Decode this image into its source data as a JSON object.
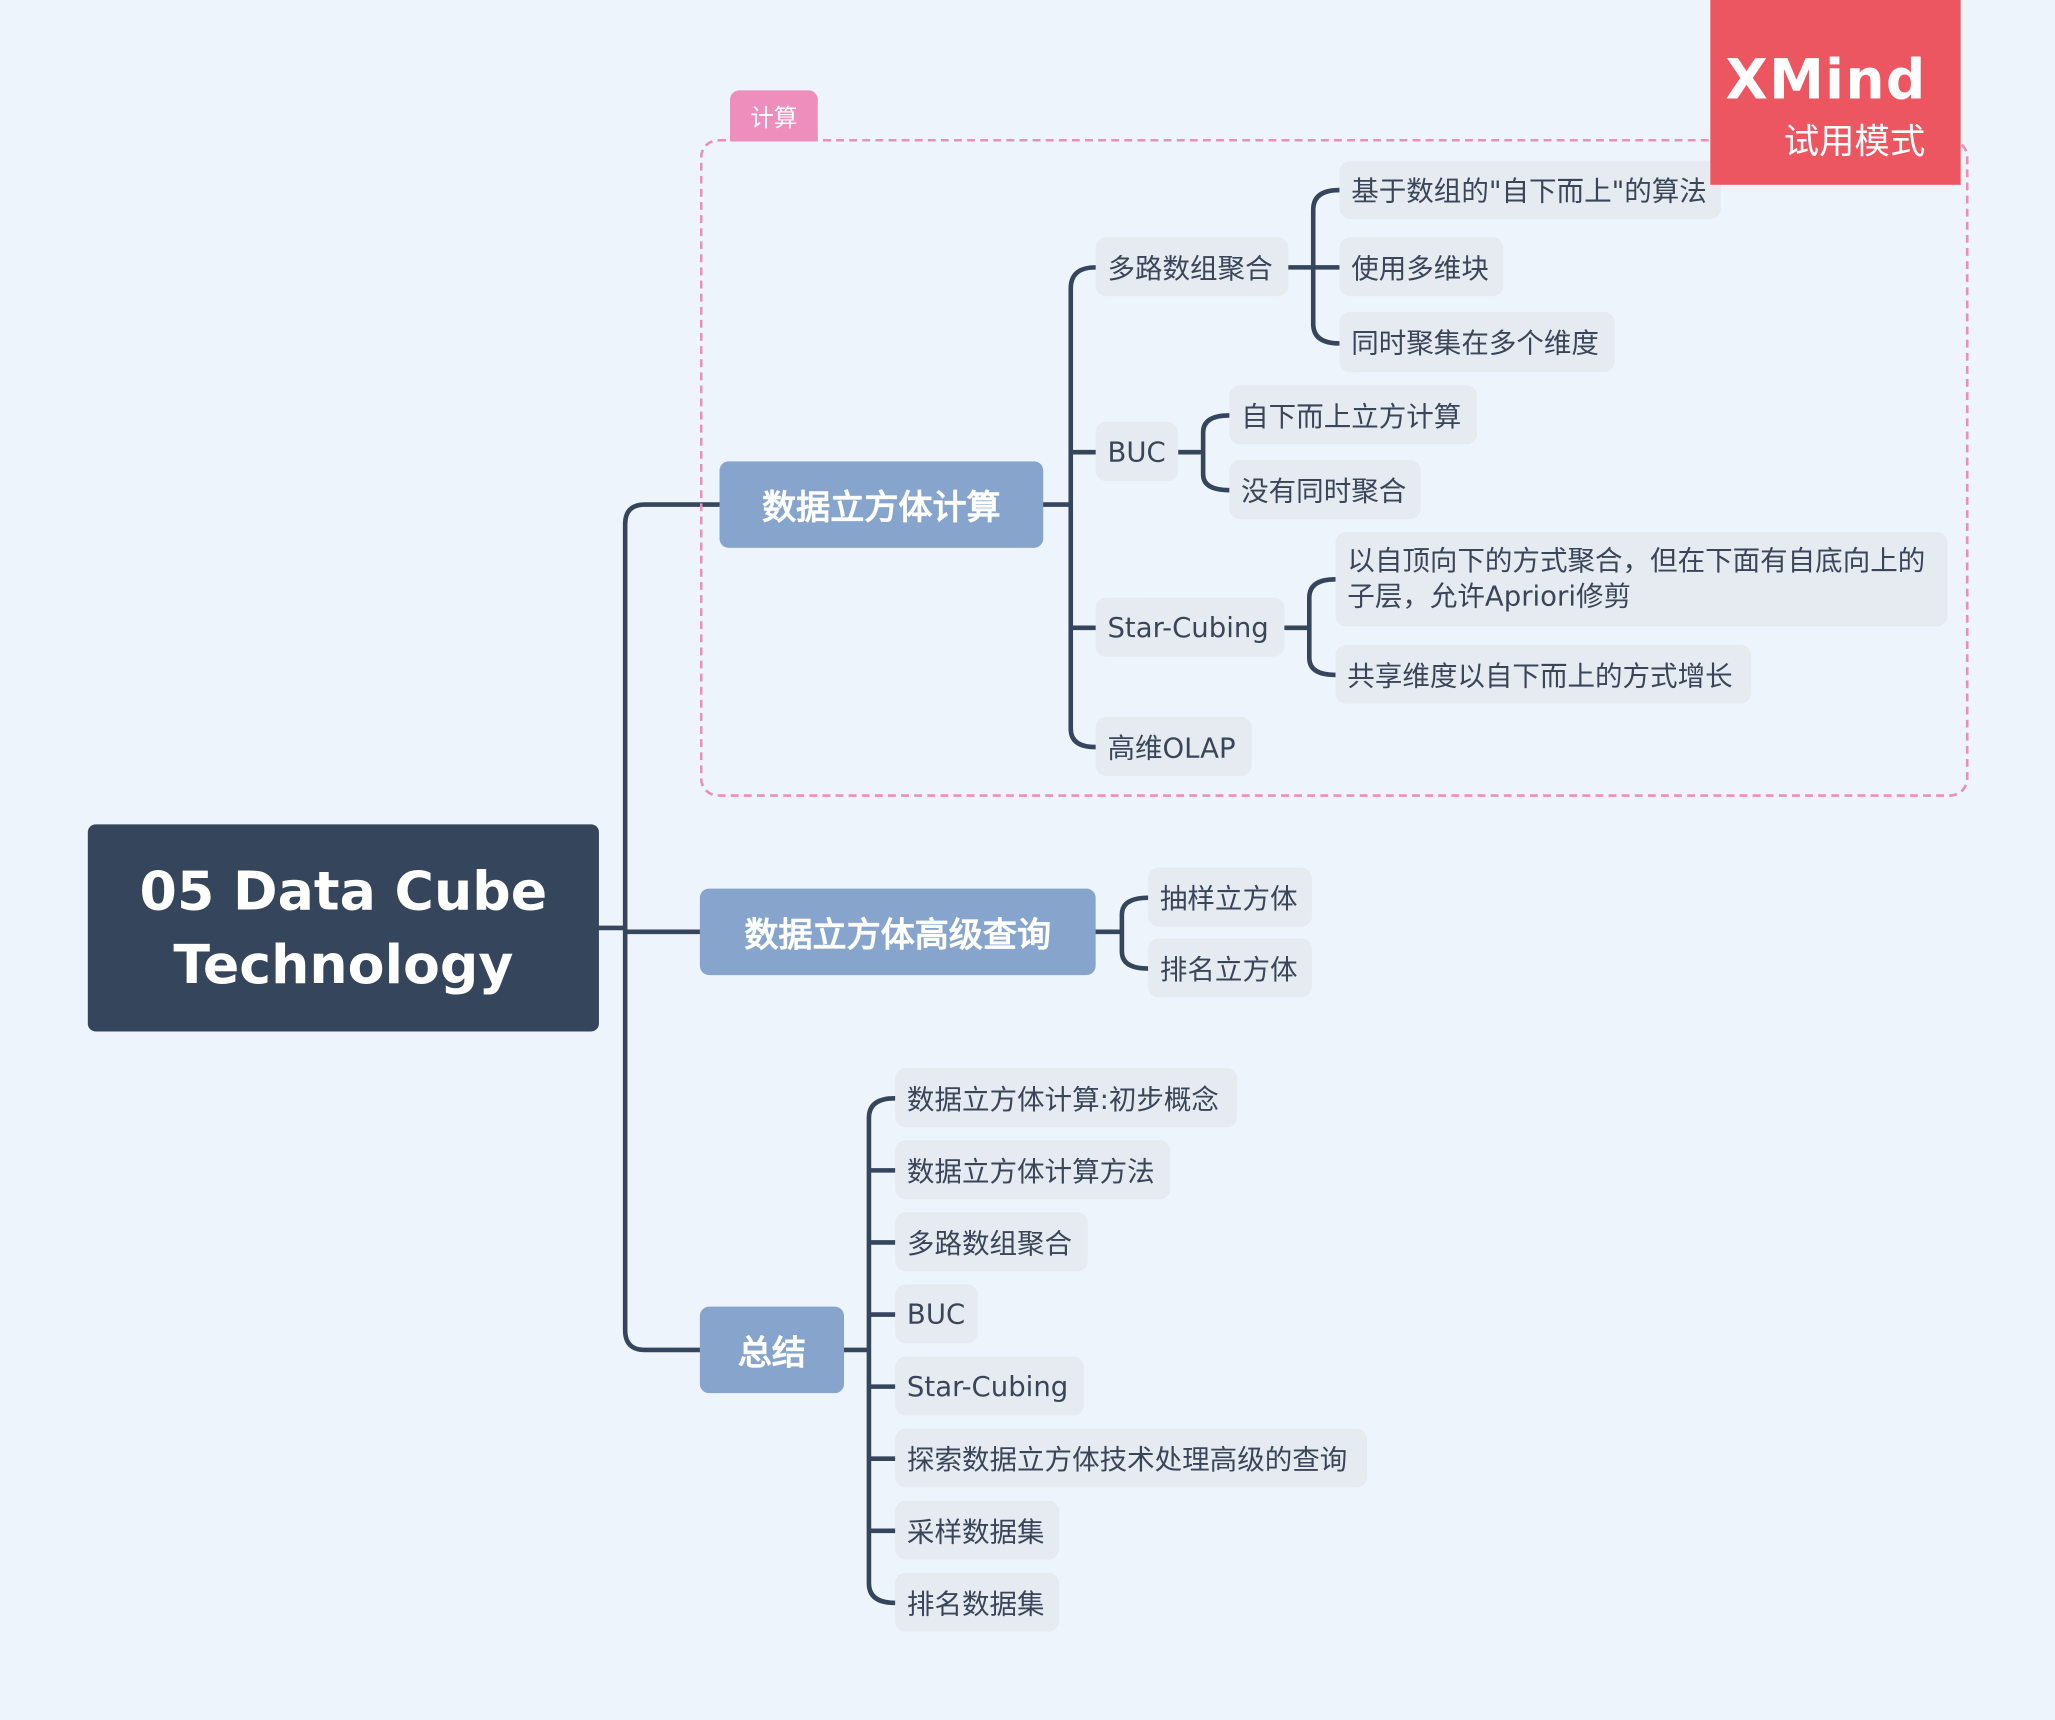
{
  "root": {
    "title": "05 Data Cube Technology"
  },
  "boundary": {
    "label": "计算"
  },
  "watermark": {
    "brand": "XMind",
    "mode": "试用模式"
  },
  "branches": [
    {
      "label": "数据立方体计算",
      "children": [
        {
          "label": "多路数组聚合",
          "children": [
            {
              "label": "基于数组的\"自下而上\"的算法"
            },
            {
              "label": "使用多维块"
            },
            {
              "label": "同时聚集在多个维度"
            }
          ]
        },
        {
          "label": "BUC",
          "children": [
            {
              "label": "自下而上立方计算"
            },
            {
              "label": "没有同时聚合"
            }
          ]
        },
        {
          "label": "Star-Cubing",
          "children": [
            {
              "label": "以自顶向下的方式聚合，但在下面有自底向上的子层，允许Apriori修剪"
            },
            {
              "label": "共享维度以自下而上的方式增长"
            }
          ]
        },
        {
          "label": "高维OLAP"
        }
      ]
    },
    {
      "label": "数据立方体高级查询",
      "children": [
        {
          "label": "抽样立方体"
        },
        {
          "label": "排名立方体"
        }
      ]
    },
    {
      "label": "总结",
      "children": [
        {
          "label": "数据立方体计算:初步概念"
        },
        {
          "label": "数据立方体计算方法"
        },
        {
          "label": "多路数组聚合"
        },
        {
          "label": "BUC"
        },
        {
          "label": "Star-Cubing"
        },
        {
          "label": "探索数据立方体技术处理高级的查询"
        },
        {
          "label": "采样数据集"
        },
        {
          "label": "排名数据集"
        }
      ]
    }
  ],
  "colors": {
    "background": "#eef4fb",
    "root_fill": "#35455c",
    "branch_fill": "#87a5cc",
    "leaf_fill": "#e6ebf2",
    "connector": "#35455c",
    "boundary": "#ea8fb9",
    "watermark": "#ec5660"
  }
}
